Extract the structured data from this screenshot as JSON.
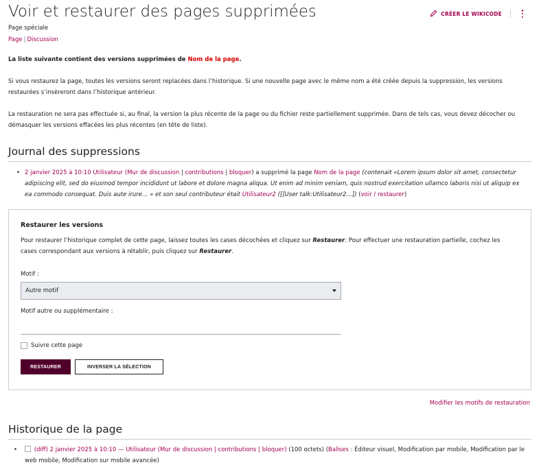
{
  "header": {
    "title": "Voir et restaurer des pages supprimées",
    "subtitle": "Page spéciale",
    "tab_page": "Page",
    "tab_separator": "|",
    "tab_discussion": "Discussion",
    "wikicode_button": "Créer le wikicode"
  },
  "intro": {
    "line1_prefix": "La liste suivante contient des versions supprimées de ",
    "line1_page": "Nom de la page",
    "line1_suffix": ".",
    "para2": "Si vous restaurez la page, toutes les versions seront replacées dans l’historique. Si une nouvelle page avec le même nom a été créée depuis la suppression, les versions restaurées s’insèreront dans l’historique antérieur.",
    "para3": "La restauration ne sera pas effectuée si, au final, la version la plus récente de la page ou du fichier reste partiellement supprimée. Dans de tels cas, vous devez décocher ou démasquer les versions effacées les plus récentes (en tête de liste)."
  },
  "journal": {
    "heading": "Journal des suppressions",
    "entry": {
      "bullet": "•",
      "timestamp_user": "2 janvier 2025 à 10:10 Utilisateur",
      "open_paren": " (",
      "talk": "Mur de discussion",
      "sep": " | ",
      "contribs": "contributions",
      "block": "bloquer",
      "close_text": ") a supprimé la page ",
      "page": "Nom de la page",
      "comment_prefix": " (contenait «Lorem ipsum dolor sit amet, consectetur adipiscing elit, sed do eiusmod tempor incididunt ut labore et dolore magna aliqua. Ut enim ad minim veniam, quis nostrud exercitation ullamco laboris nisi ut aliquip ex ea commodo consequat. Duis aute irure… » et son seul contributeur était ",
      "contributor": "Utilisateur2",
      "comment_suffix": " ([[User talk:Utilisateur2…])",
      "view_restore_open": " (",
      "view_restore": "voir / restaurer",
      "view_restore_close": ")"
    }
  },
  "restore": {
    "title": "Restaurer les versions",
    "desc_part1": "Pour restaurer l’historique complet de cette page, laissez toutes les cases décochées et cliquez sur ",
    "restaurer_word": "Restaurer",
    "desc_part2": ". Pour effectuer une restauration partielle, cochez les cases correspondant aux versions à rétablir, puis cliquez sur ",
    "desc_part3": ".",
    "motif_label": "Motif :",
    "motif_value": "Autre motif",
    "other_label": "Motif autre ou supplémentaire :",
    "watch_label": "Suivre cette page",
    "restore_button": "Restaurer",
    "invert_button": "Inverser la sélection"
  },
  "modify_reasons_link": "Modifier les motifs de restauration",
  "history": {
    "heading": "Historique de la page",
    "entry": {
      "bullet": "•",
      "diff": "(diff)",
      "timestamp": " 2 janvier 2025 à 10:10",
      "dash": " — ",
      "user": "Utilisateur",
      "open_paren": " (",
      "talk": "Mur de discussion",
      "sep": " | ",
      "contribs": "contributions",
      "block": "bloquer",
      "close_paren": ")",
      "size": " (100 octets) (",
      "tags_link": "Balises",
      "tags": " : Éditeur visuel, Modification par mobile, Modification par le web mobile, Modification sur mobile avancée)"
    }
  },
  "colors": {
    "accent": "#a3004f",
    "primary_button": "#51002c",
    "red_link": "#d40000"
  }
}
